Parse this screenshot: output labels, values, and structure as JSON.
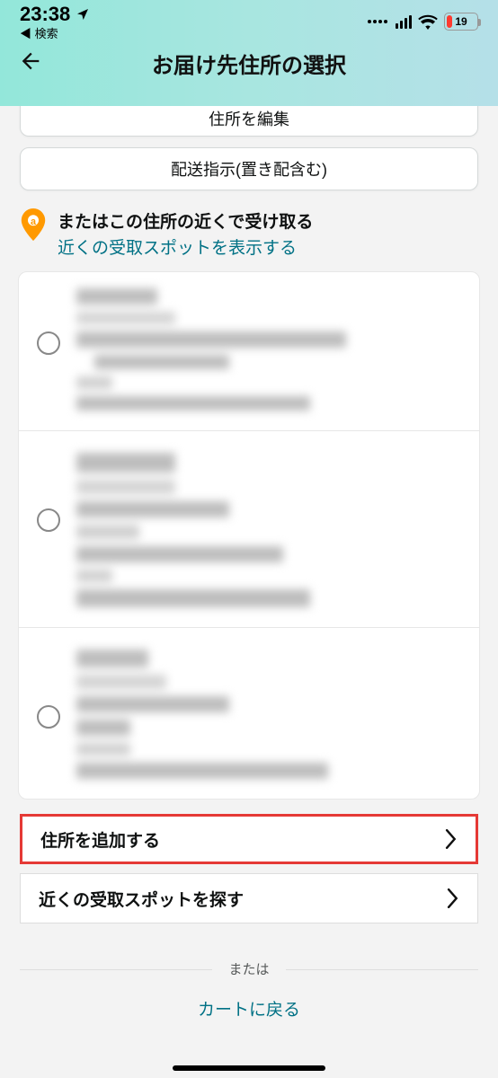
{
  "status": {
    "time": "23:38",
    "back_app": "◀ 検索",
    "battery_pct": "19"
  },
  "nav": {
    "title": "お届け先住所の選択"
  },
  "buttons": {
    "edit_address": "住所を編集",
    "delivery_instructions": "配送指示(置き配含む)"
  },
  "nearby": {
    "title": "またはこの住所の近くで受け取る",
    "link": "近くの受取スポットを表示する"
  },
  "actions": {
    "add_address": "住所を追加する",
    "find_pickup": "近くの受取スポットを探す"
  },
  "footer": {
    "or": "または",
    "return_cart": "カートに戻る"
  }
}
